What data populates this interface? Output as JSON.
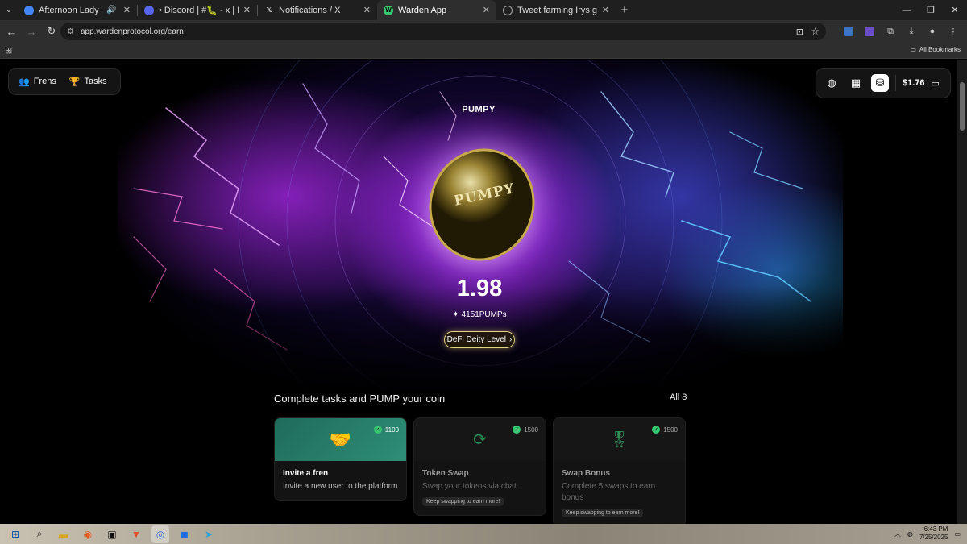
{
  "browser": {
    "tabs": [
      {
        "title": "Afternoon Lady II - Park Ji",
        "favicon": "chrome-icon",
        "sound": true,
        "active": false
      },
      {
        "title": "• Discord | #🐛 - x | RISE Chain",
        "favicon": "discord-icon",
        "active": false
      },
      {
        "title": "Notifications / X",
        "favicon": "x-icon",
        "active": false
      },
      {
        "title": "Warden App",
        "favicon": "warden-icon",
        "active": true
      },
      {
        "title": "Tweet farming Irys guide",
        "favicon": "globe-icon",
        "active": false
      }
    ],
    "url": "app.wardenprotocol.org/earn",
    "bookmarks_all": "All Bookmarks"
  },
  "app": {
    "nav": {
      "frens": "Frens",
      "tasks": "Tasks"
    },
    "balance": "$1.76",
    "token_label": "PUMPY",
    "coin_text": "PUMPY",
    "value": "1.98",
    "pumps": "4151PUMPs",
    "level": "DeFi Deity Level",
    "section_title": "Complete tasks and PUMP your coin",
    "section_all": "All 8",
    "cards": [
      {
        "name": "Invite a fren",
        "desc": "Invite a new user to the platform",
        "points": "1100",
        "keep": "",
        "icon": "handshake-icon"
      },
      {
        "name": "Token Swap",
        "desc": "Swap your tokens via chat",
        "points": "1500",
        "keep": "Keep swapping to earn more!",
        "icon": "swap-icon"
      },
      {
        "name": "Swap Bonus",
        "desc": "Complete 5 swaps to earn bonus",
        "points": "1500",
        "keep": "Keep swapping to earn more!",
        "icon": "medal-icon"
      }
    ]
  },
  "taskbar": {
    "time": "6:43 PM",
    "date": "7/25/2025"
  },
  "colors": {
    "accent_green": "#37c871",
    "level_gold": "#e6d38a",
    "card_teal": "#1f6b5a"
  }
}
